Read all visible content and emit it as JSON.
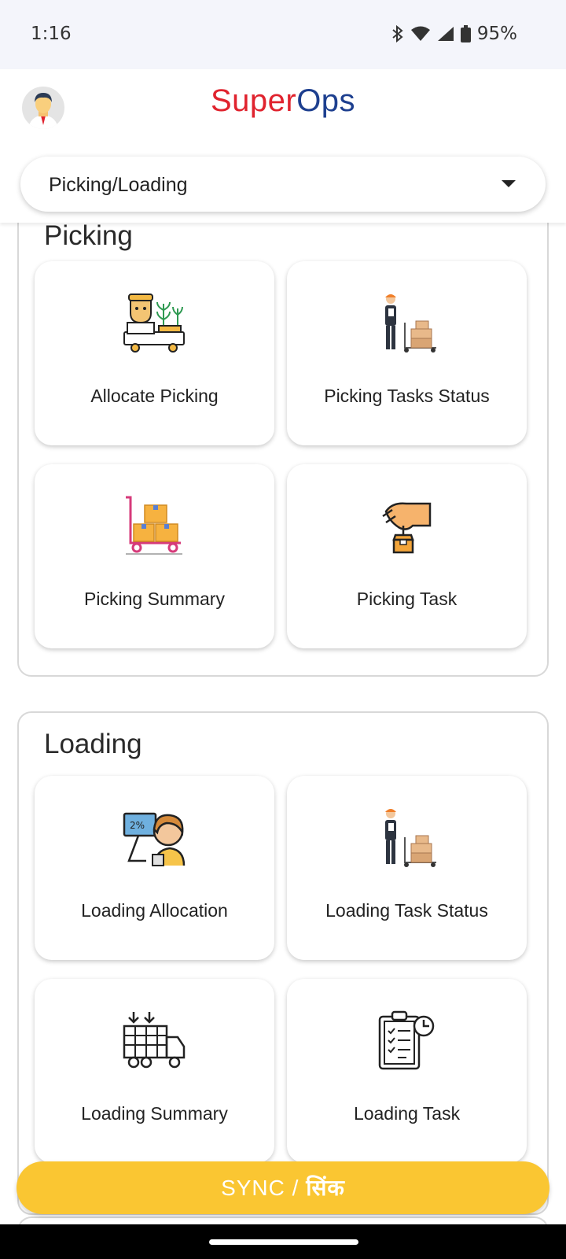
{
  "status_bar": {
    "time": "1:16",
    "battery": "95%"
  },
  "header": {
    "brand_part1": "Super",
    "brand_part2": "Ops",
    "brand_color_1": "#e0232e",
    "brand_color_2": "#1d3f8f"
  },
  "dropdown": {
    "value": "Picking/Loading"
  },
  "sections": [
    {
      "title": "Picking",
      "cards": [
        {
          "label": "Allocate Picking",
          "icon": "allocate-picking-icon"
        },
        {
          "label": "Picking Tasks Status",
          "icon": "worker-pallet-icon"
        },
        {
          "label": "Picking Summary",
          "icon": "trolley-boxes-icon"
        },
        {
          "label": "Picking Task",
          "icon": "hand-box-icon"
        }
      ]
    },
    {
      "title": "Loading",
      "cards": [
        {
          "label": "Loading Allocation",
          "icon": "computer-operator-icon"
        },
        {
          "label": "Loading Task Status",
          "icon": "worker-pallet-icon"
        },
        {
          "label": "Loading Summary",
          "icon": "truck-loading-icon"
        },
        {
          "label": "Loading Task",
          "icon": "clipboard-checklist-icon"
        }
      ]
    }
  ],
  "sync_button": {
    "label": "SYNC / ",
    "label_hindi": "सिंक",
    "color": "#fac632"
  }
}
